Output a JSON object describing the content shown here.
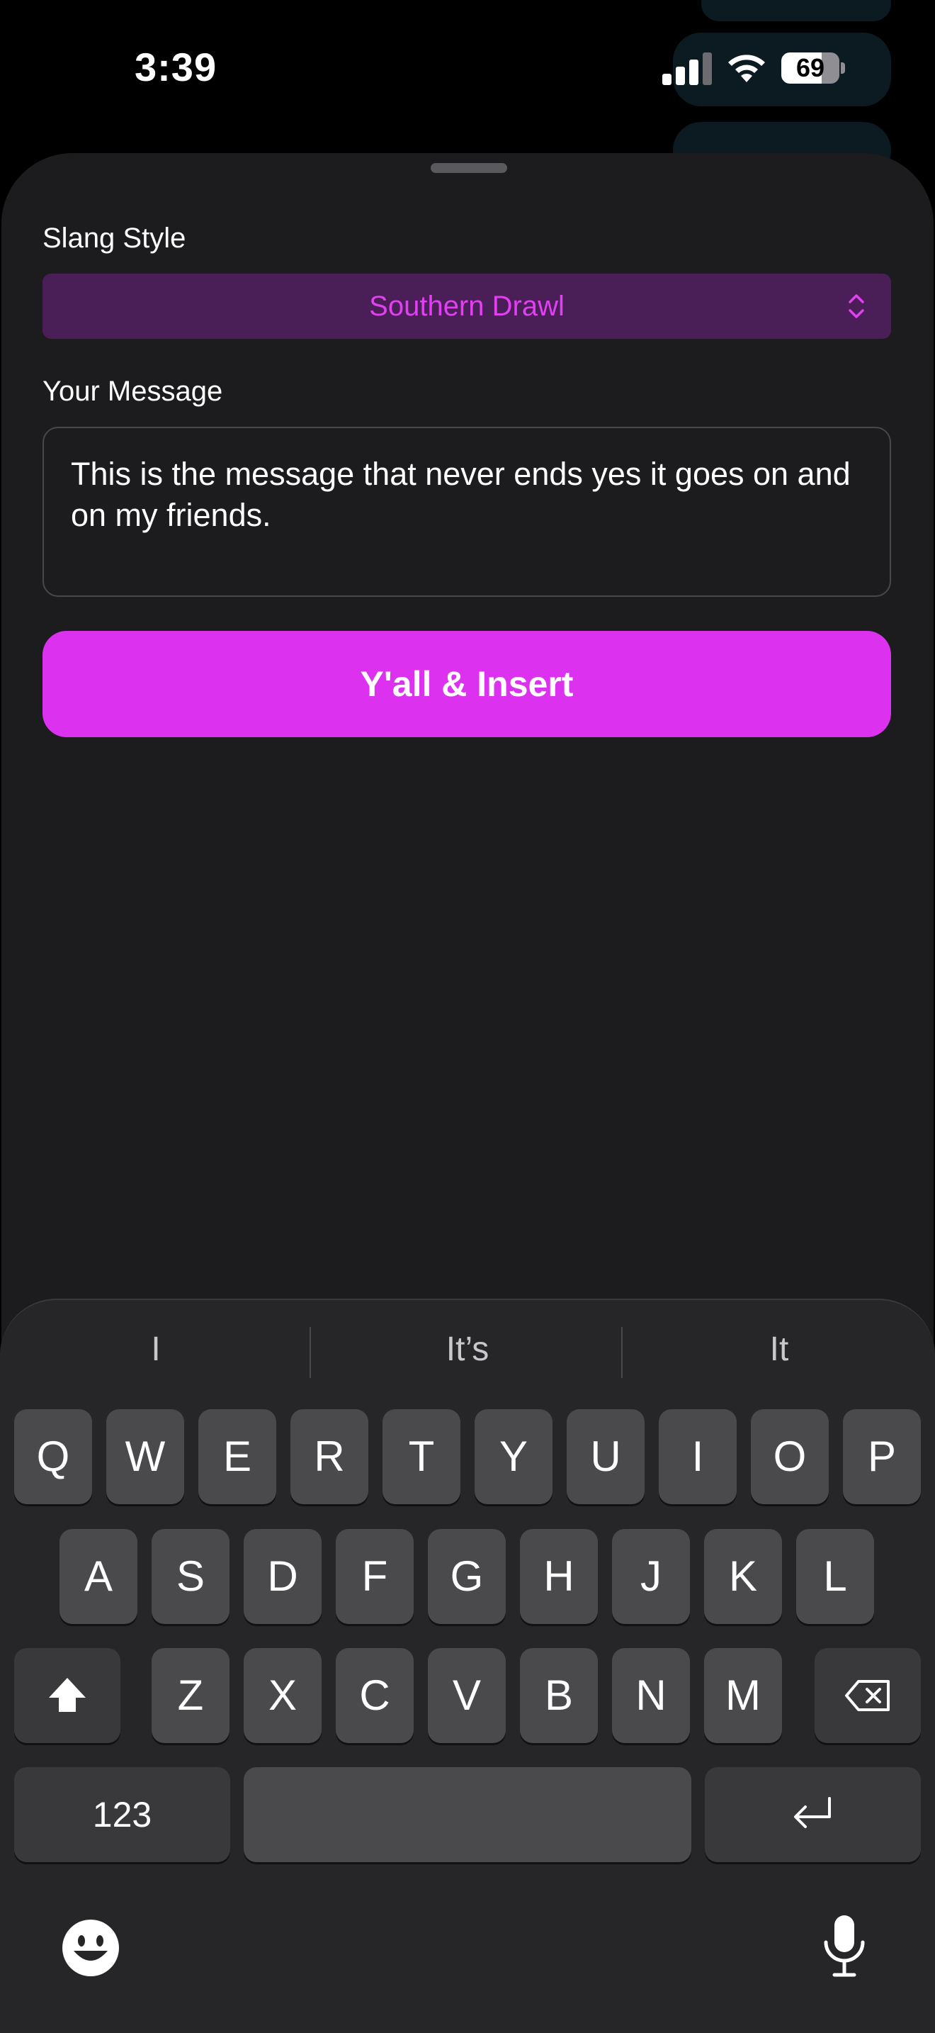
{
  "status_bar": {
    "time": "3:39",
    "battery_percent": "69",
    "battery_level": 0.69
  },
  "form": {
    "slang_style_label": "Slang Style",
    "slang_style_value": "Southern Drawl",
    "message_label": "Your Message",
    "message_text": "This is the message that never ends yes it goes on and on my friends.",
    "submit_label": "Y'all & Insert"
  },
  "keyboard": {
    "suggestions": [
      "I",
      "It’s",
      "It"
    ],
    "row1": [
      "Q",
      "W",
      "E",
      "R",
      "T",
      "Y",
      "U",
      "I",
      "O",
      "P"
    ],
    "row2": [
      "A",
      "S",
      "D",
      "F",
      "G",
      "H",
      "J",
      "K",
      "L"
    ],
    "row3": [
      "Z",
      "X",
      "C",
      "V",
      "B",
      "N",
      "M"
    ],
    "numbers_label": "123",
    "icons": {
      "shift": "shift-icon",
      "delete": "backspace-icon",
      "return": "return-icon",
      "emoji": "emoji-icon",
      "dictation": "microphone-icon"
    }
  },
  "colors": {
    "accent": "#dc32f0",
    "picker_bg": "#4a1f57",
    "picker_text": "#e040f0",
    "sheet_bg": "#1c1c1e",
    "keyboard_bg": "#262629"
  }
}
